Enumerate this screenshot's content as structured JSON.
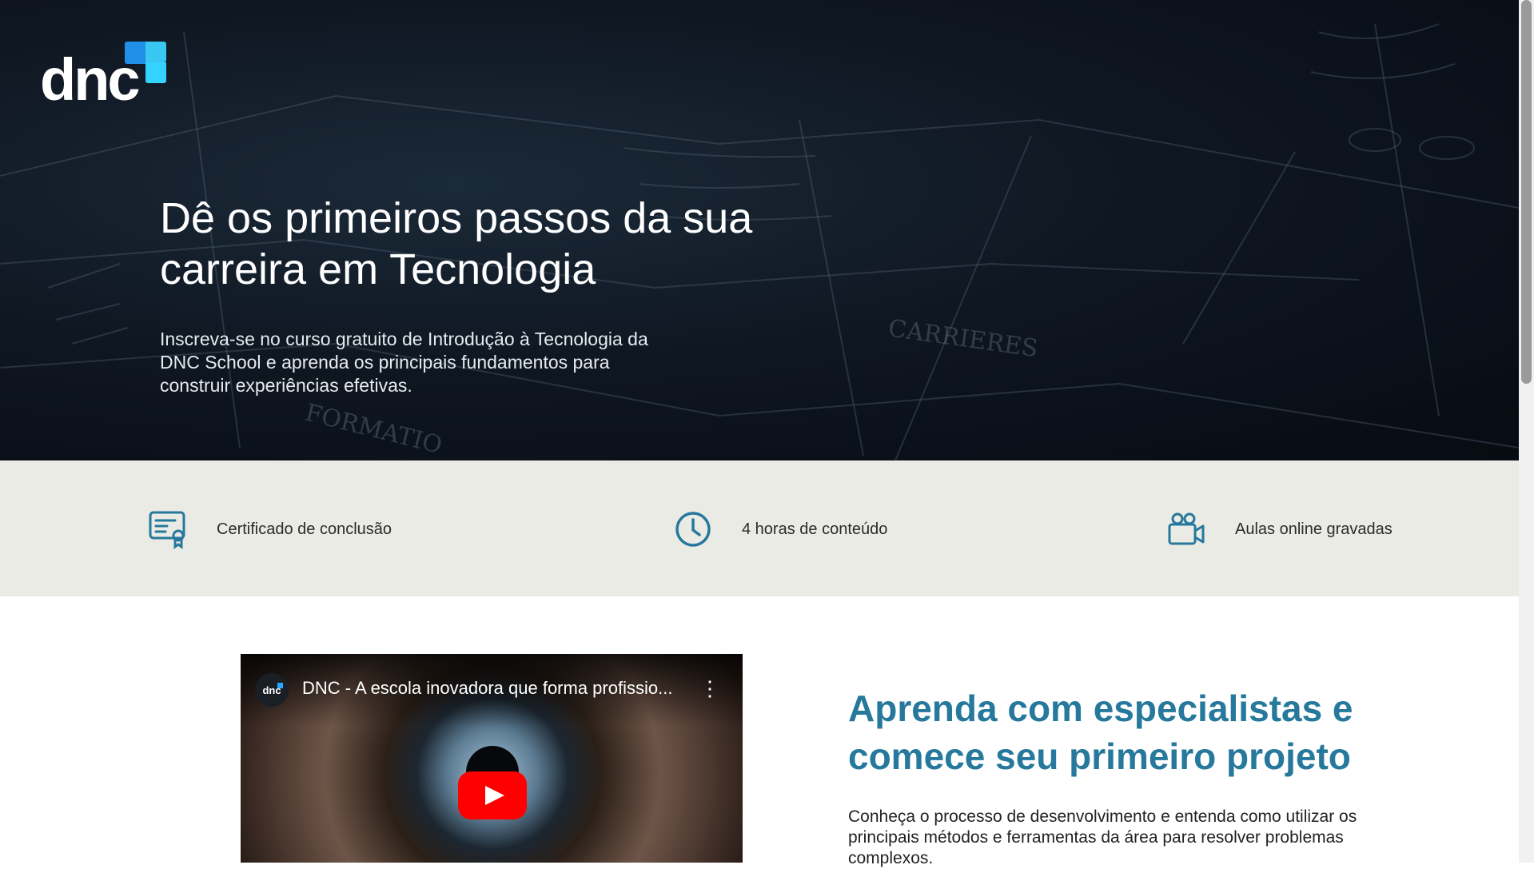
{
  "brand": {
    "logo_text": "dnc",
    "accent_color": "#1f8fe8"
  },
  "hero": {
    "title": "Dê os primeiros passos da sua carreira em Tecnologia",
    "subtitle": "Inscreva-se no curso gratuito de Introdução à Tecnologia da DNC School e aprenda os principais fundamentos para construir experiências efetivas."
  },
  "features": [
    {
      "icon": "certificate-icon",
      "label": "Certificado de conclusão"
    },
    {
      "icon": "clock-icon",
      "label": "4 horas de conteúdo"
    },
    {
      "icon": "video-camera-icon",
      "label": "Aulas online gravadas"
    }
  ],
  "video": {
    "channel_avatar_text": "dnc",
    "title": "DNC - A escola inovadora que forma profissio...",
    "menu_icon": "more-vertical-icon",
    "play_icon": "play-icon",
    "play_color": "#ff0000"
  },
  "section": {
    "title": "Aprenda com especialistas e comece seu primeiro projeto",
    "text": "Conheça o processo de desenvolvimento e entenda como utilizar os principais métodos e ferramentas da área para resolver problemas complexos.",
    "title_color": "#26799c"
  }
}
